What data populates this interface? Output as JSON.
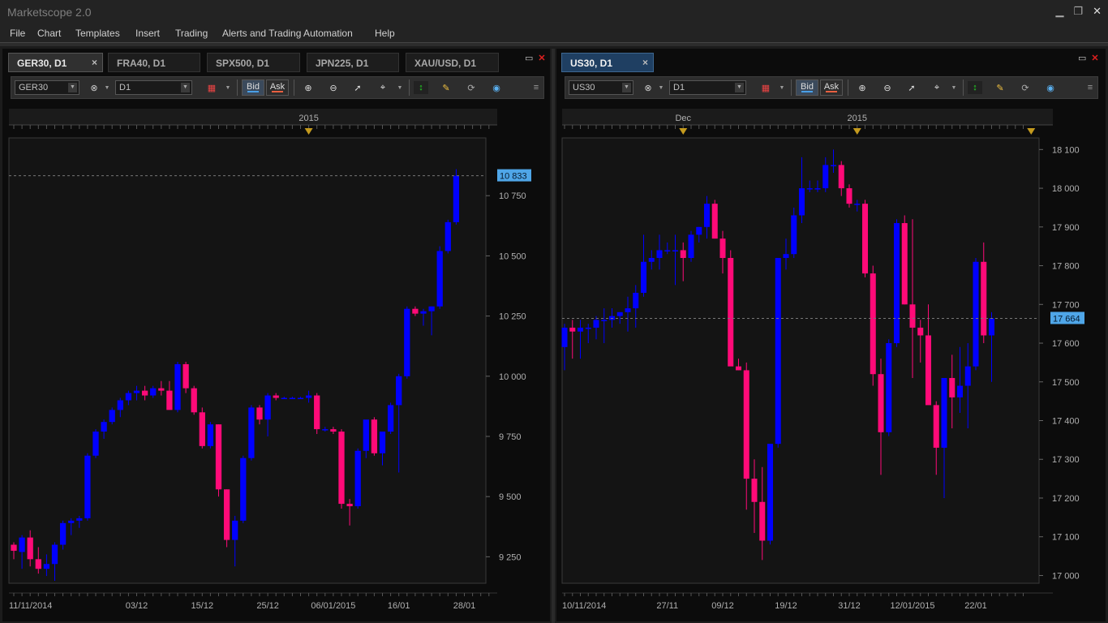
{
  "app": {
    "title": "Marketscope 2.0"
  },
  "window_controls": {
    "minimize": "▁",
    "restore": "❐",
    "close": "✕"
  },
  "menu": [
    "File",
    "Chart",
    "Templates",
    "Insert",
    "Trading",
    "Alerts and Trading Automation",
    "Help"
  ],
  "colors": {
    "bull": "#0000ff",
    "bear": "#ff0a78",
    "price_label": "#4fa6e8",
    "year_marker": "#c49a1e"
  },
  "left_panel": {
    "tabs": [
      {
        "label": "GER30, D1",
        "active": true,
        "close": "×"
      },
      {
        "label": "FRA40, D1",
        "active": false
      },
      {
        "label": "SPX500, D1",
        "active": false
      },
      {
        "label": "JPN225, D1",
        "active": false
      },
      {
        "label": "XAU/USD, D1",
        "active": false
      }
    ],
    "toolbar": {
      "symbol": "GER30",
      "timeframe": "D1",
      "bid": "Bid",
      "ask": "Ask"
    }
  },
  "right_panel": {
    "tabs": [
      {
        "label": "US30, D1",
        "active": true,
        "close": "×"
      }
    ],
    "toolbar": {
      "symbol": "US30",
      "timeframe": "D1",
      "bid": "Bid",
      "ask": "Ask"
    }
  },
  "chart_data": [
    {
      "type": "candlestick",
      "symbol": "GER30",
      "ylim": [
        9140,
        10990
      ],
      "y_ticks": [
        {
          "v": 9250,
          "label": "9 250"
        },
        {
          "v": 9500,
          "label": "9 500"
        },
        {
          "v": 9750,
          "label": "9 750"
        },
        {
          "v": 10000,
          "label": "10 000"
        },
        {
          "v": 10250,
          "label": "10 250"
        },
        {
          "v": 10500,
          "label": "10 500"
        },
        {
          "v": 10750,
          "label": "10 750"
        }
      ],
      "x_ticks": [
        {
          "i": 0,
          "label": "11/11/2014"
        },
        {
          "i": 15,
          "label": "03/12"
        },
        {
          "i": 23,
          "label": "15/12"
        },
        {
          "i": 31,
          "label": "25/12"
        },
        {
          "i": 39,
          "label": "06/01/2015"
        },
        {
          "i": 47,
          "label": "16/01"
        },
        {
          "i": 55,
          "label": "28/01"
        }
      ],
      "top_ticks": [
        {
          "i": 36,
          "label": "2015"
        }
      ],
      "current_price": {
        "value": 10833,
        "label": "10 833"
      },
      "candles": [
        [
          9300,
          9310,
          9240,
          9275
        ],
        [
          9270,
          9340,
          9200,
          9330
        ],
        [
          9330,
          9360,
          9210,
          9240
        ],
        [
          9240,
          9290,
          9180,
          9200
        ],
        [
          9200,
          9260,
          9170,
          9220
        ],
        [
          9220,
          9310,
          9150,
          9300
        ],
        [
          9300,
          9400,
          9280,
          9390
        ],
        [
          9390,
          9410,
          9340,
          9400
        ],
        [
          9400,
          9420,
          9370,
          9410
        ],
        [
          9410,
          9680,
          9400,
          9670
        ],
        [
          9670,
          9780,
          9660,
          9770
        ],
        [
          9770,
          9820,
          9740,
          9810
        ],
        [
          9810,
          9870,
          9800,
          9860
        ],
        [
          9860,
          9910,
          9830,
          9900
        ],
        [
          9900,
          9940,
          9880,
          9930
        ],
        [
          9930,
          9960,
          9900,
          9940
        ],
        [
          9940,
          9960,
          9900,
          9920
        ],
        [
          9920,
          9960,
          9910,
          9950
        ],
        [
          9950,
          9980,
          9920,
          9940
        ],
        [
          9940,
          9980,
          9880,
          9860
        ],
        [
          9860,
          10060,
          9850,
          10050
        ],
        [
          10050,
          10060,
          9930,
          9950
        ],
        [
          9950,
          9960,
          9840,
          9850
        ],
        [
          9850,
          9870,
          9700,
          9710
        ],
        [
          9710,
          9810,
          9700,
          9800
        ],
        [
          9800,
          9800,
          9500,
          9530
        ],
        [
          9530,
          9530,
          9290,
          9320
        ],
        [
          9320,
          9420,
          9210,
          9400
        ],
        [
          9400,
          9670,
          9390,
          9660
        ],
        [
          9660,
          9880,
          9650,
          9870
        ],
        [
          9870,
          9880,
          9800,
          9820
        ],
        [
          9820,
          9930,
          9750,
          9920
        ],
        [
          9920,
          9930,
          9900,
          9910
        ],
        [
          9910,
          9915,
          9905,
          9910
        ],
        [
          9910,
          9915,
          9905,
          9910
        ],
        [
          9910,
          9915,
          9905,
          9910
        ],
        [
          9910,
          9940,
          9890,
          9920
        ],
        [
          9920,
          9930,
          9760,
          9780
        ],
        [
          9780,
          9790,
          9770,
          9780
        ],
        [
          9780,
          9790,
          9760,
          9770
        ],
        [
          9770,
          9780,
          9450,
          9470
        ],
        [
          9470,
          9490,
          9380,
          9460
        ],
        [
          9460,
          9700,
          9450,
          9690
        ],
        [
          9690,
          9790,
          9660,
          9820
        ],
        [
          9820,
          9830,
          9670,
          9680
        ],
        [
          9680,
          9700,
          9630,
          9770
        ],
        [
          9770,
          9890,
          9760,
          9880
        ],
        [
          9880,
          10010,
          9600,
          10000
        ],
        [
          10000,
          10290,
          9990,
          10280
        ],
        [
          10280,
          10290,
          10250,
          10260
        ],
        [
          10260,
          10280,
          10210,
          10270
        ],
        [
          10270,
          10290,
          10170,
          10290
        ],
        [
          10290,
          10540,
          10280,
          10520
        ],
        [
          10520,
          10650,
          10510,
          10640
        ],
        [
          10640,
          10860,
          10630,
          10833
        ]
      ]
    },
    {
      "type": "candlestick",
      "symbol": "US30",
      "ylim": [
        16980,
        18130
      ],
      "y_ticks": [
        {
          "v": 17000,
          "label": "17 000"
        },
        {
          "v": 17100,
          "label": "17 100"
        },
        {
          "v": 17200,
          "label": "17 200"
        },
        {
          "v": 17300,
          "label": "17 300"
        },
        {
          "v": 17400,
          "label": "17 400"
        },
        {
          "v": 17500,
          "label": "17 500"
        },
        {
          "v": 17600,
          "label": "17 600"
        },
        {
          "v": 17700,
          "label": "17 700"
        },
        {
          "v": 17800,
          "label": "17 800"
        },
        {
          "v": 17900,
          "label": "17 900"
        },
        {
          "v": 18000,
          "label": "18 000"
        },
        {
          "v": 18100,
          "label": "18 100"
        }
      ],
      "x_ticks": [
        {
          "i": 0,
          "label": "10/11/2014"
        },
        {
          "i": 13,
          "label": "27/11"
        },
        {
          "i": 20,
          "label": "09/12"
        },
        {
          "i": 28,
          "label": "19/12"
        },
        {
          "i": 36,
          "label": "31/12"
        },
        {
          "i": 44,
          "label": "12/01/2015"
        },
        {
          "i": 52,
          "label": "22/01"
        }
      ],
      "top_ticks": [
        {
          "i": 15,
          "label": "Dec"
        },
        {
          "i": 37,
          "label": "2015"
        },
        {
          "i": 59,
          "label": ""
        }
      ],
      "current_price": {
        "value": 17664,
        "label": "17 664"
      },
      "candles": [
        [
          17590,
          17650,
          17530,
          17640
        ],
        [
          17640,
          17660,
          17560,
          17630
        ],
        [
          17630,
          17660,
          17560,
          17640
        ],
        [
          17640,
          17650,
          17600,
          17640
        ],
        [
          17640,
          17670,
          17610,
          17660
        ],
        [
          17660,
          17690,
          17600,
          17660
        ],
        [
          17660,
          17690,
          17640,
          17670
        ],
        [
          17670,
          17680,
          17650,
          17680
        ],
        [
          17680,
          17720,
          17630,
          17690
        ],
        [
          17690,
          17750,
          17640,
          17730
        ],
        [
          17730,
          17880,
          17720,
          17810
        ],
        [
          17810,
          17840,
          17790,
          17820
        ],
        [
          17820,
          17880,
          17790,
          17840
        ],
        [
          17840,
          17860,
          17830,
          17840
        ],
        [
          17840,
          17880,
          17750,
          17840
        ],
        [
          17840,
          17860,
          17760,
          17820
        ],
        [
          17820,
          17890,
          17810,
          17880
        ],
        [
          17880,
          17900,
          17860,
          17900
        ],
        [
          17900,
          17980,
          17870,
          17960
        ],
        [
          17960,
          17970,
          17870,
          17870
        ],
        [
          17870,
          17890,
          17780,
          17820
        ],
        [
          17820,
          17840,
          17560,
          17540
        ],
        [
          17540,
          17560,
          17530,
          17530
        ],
        [
          17530,
          17550,
          17170,
          17250
        ],
        [
          17250,
          17300,
          17110,
          17190
        ],
        [
          17190,
          17280,
          17040,
          17090
        ],
        [
          17090,
          17340,
          17080,
          17340
        ],
        [
          17340,
          17820,
          17330,
          17820
        ],
        [
          17820,
          17870,
          17790,
          17830
        ],
        [
          17830,
          17950,
          17820,
          17930
        ],
        [
          17930,
          18080,
          17910,
          18000
        ],
        [
          18000,
          18020,
          17990,
          18000
        ],
        [
          18000,
          18020,
          17990,
          18000
        ],
        [
          18000,
          18080,
          17990,
          18060
        ],
        [
          18060,
          18100,
          18040,
          18060
        ],
        [
          18060,
          18070,
          17980,
          18000
        ],
        [
          18000,
          18010,
          17950,
          17960
        ],
        [
          17960,
          17970,
          17940,
          17960
        ],
        [
          17960,
          17970,
          17770,
          17780
        ],
        [
          17780,
          17800,
          17490,
          17520
        ],
        [
          17520,
          17560,
          17260,
          17370
        ],
        [
          17370,
          17610,
          17360,
          17600
        ],
        [
          17600,
          17920,
          17590,
          17910
        ],
        [
          17910,
          17930,
          17700,
          17700
        ],
        [
          17700,
          17920,
          17510,
          17640
        ],
        [
          17640,
          17660,
          17550,
          17620
        ],
        [
          17620,
          17700,
          17450,
          17440
        ],
        [
          17440,
          17450,
          17260,
          17330
        ],
        [
          17330,
          17510,
          17200,
          17510
        ],
        [
          17510,
          17570,
          17380,
          17460
        ],
        [
          17460,
          17590,
          17420,
          17490
        ],
        [
          17490,
          17600,
          17380,
          17540
        ],
        [
          17540,
          17820,
          17530,
          17810
        ],
        [
          17810,
          17860,
          17600,
          17620
        ],
        [
          17620,
          17680,
          17500,
          17664
        ]
      ]
    }
  ]
}
